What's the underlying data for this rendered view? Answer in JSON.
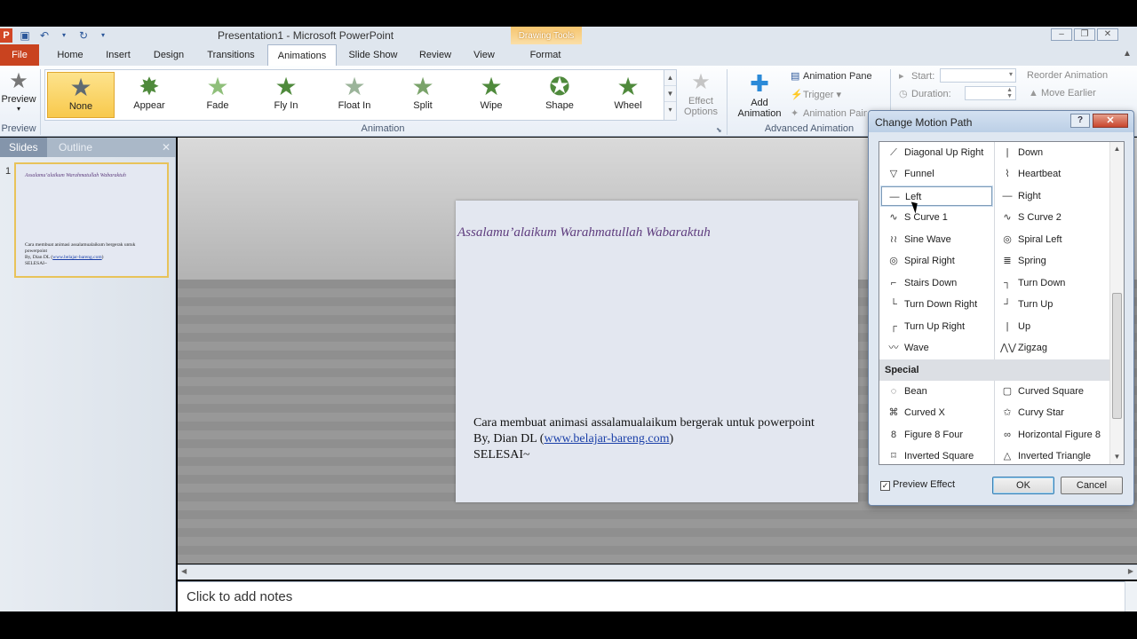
{
  "window": {
    "title": "Presentation1 - Microsoft PowerPoint",
    "app_icon": "P",
    "contextual_tab_group": "Drawing Tools"
  },
  "tabs": [
    "Home",
    "Insert",
    "Design",
    "Transitions",
    "Animations",
    "Slide Show",
    "Review",
    "View",
    "Format"
  ],
  "file_tab": "File",
  "active_tab": "Animations",
  "ribbon": {
    "preview": {
      "label": "Preview",
      "group": "Preview"
    },
    "effects": [
      {
        "label": "None",
        "selected": true
      },
      {
        "label": "Appear"
      },
      {
        "label": "Fade"
      },
      {
        "label": "Fly In"
      },
      {
        "label": "Float In"
      },
      {
        "label": "Split"
      },
      {
        "label": "Wipe"
      },
      {
        "label": "Shape"
      },
      {
        "label": "Wheel"
      }
    ],
    "effect_options": "Effect Options",
    "animation_group": "Animation",
    "add_animation": "Add Animation",
    "animation_pane": "Animation Pane",
    "trigger": "Trigger",
    "animation_painter": "Animation Painter",
    "advanced_group": "Advanced Animation",
    "start": "Start:",
    "duration": "Duration:",
    "reorder": "Reorder Animation",
    "move_earlier": "Move Earlier"
  },
  "left_pane": {
    "tabs": [
      "Slides",
      "Outline"
    ],
    "slide_number": "1"
  },
  "slide": {
    "title": "Assalamu’alaikum Warahmatullah Wabaraktuh",
    "line1": "Cara membuat animasi assalamualaikum bergerak untuk powerpoint",
    "line2_prefix": "By, Dian DL (",
    "line2_link": "www.belajar-bareng.com",
    "line2_suffix": ")",
    "line3": "SELESAI~"
  },
  "notes_placeholder": "Click to add notes",
  "dialog": {
    "title": "Change Motion Path",
    "help": "?",
    "items_left": [
      {
        "label": "Diagonal Up Right",
        "icon": "diagonal-line-icon"
      },
      {
        "label": "Funnel",
        "icon": "funnel-icon"
      },
      {
        "label": "Left",
        "icon": "horizontal-line-icon",
        "selected": true
      },
      {
        "label": "S Curve 1",
        "icon": "s-curve-icon"
      },
      {
        "label": "Sine Wave",
        "icon": "sine-wave-icon"
      },
      {
        "label": "Spiral Right",
        "icon": "spiral-icon"
      },
      {
        "label": "Stairs Down",
        "icon": "stairs-icon"
      },
      {
        "label": "Turn Down Right",
        "icon": "turn-icon"
      },
      {
        "label": "Turn Up Right",
        "icon": "turn-icon"
      },
      {
        "label": "Wave",
        "icon": "wave-icon"
      }
    ],
    "items_right": [
      {
        "label": "Down",
        "icon": "vertical-line-icon"
      },
      {
        "label": "Heartbeat",
        "icon": "heartbeat-icon"
      },
      {
        "label": "Right",
        "icon": "horizontal-line-icon"
      },
      {
        "label": "S Curve 2",
        "icon": "s-curve-icon"
      },
      {
        "label": "Spiral Left",
        "icon": "spiral-icon"
      },
      {
        "label": "Spring",
        "icon": "spring-icon"
      },
      {
        "label": "Turn Down",
        "icon": "turn-icon"
      },
      {
        "label": "Turn Up",
        "icon": "turn-icon"
      },
      {
        "label": "Up",
        "icon": "vertical-line-icon"
      },
      {
        "label": "Zigzag",
        "icon": "zigzag-icon"
      }
    ],
    "special_header": "Special",
    "special_left": [
      {
        "label": "Bean",
        "icon": "bean-icon"
      },
      {
        "label": "Curved X",
        "icon": "curved-x-icon"
      },
      {
        "label": "Figure 8 Four",
        "icon": "figure8-icon"
      },
      {
        "label": "Inverted Square",
        "icon": "inverted-square-icon"
      }
    ],
    "special_right": [
      {
        "label": "Curved Square",
        "icon": "curved-square-icon"
      },
      {
        "label": "Curvy Star",
        "icon": "curvy-star-icon"
      },
      {
        "label": "Horizontal Figure 8",
        "icon": "figure8-icon"
      },
      {
        "label": "Inverted Triangle",
        "icon": "triangle-icon"
      }
    ],
    "preview_effect": "Preview Effect",
    "preview_checked": true,
    "ok": "OK",
    "cancel": "Cancel"
  }
}
